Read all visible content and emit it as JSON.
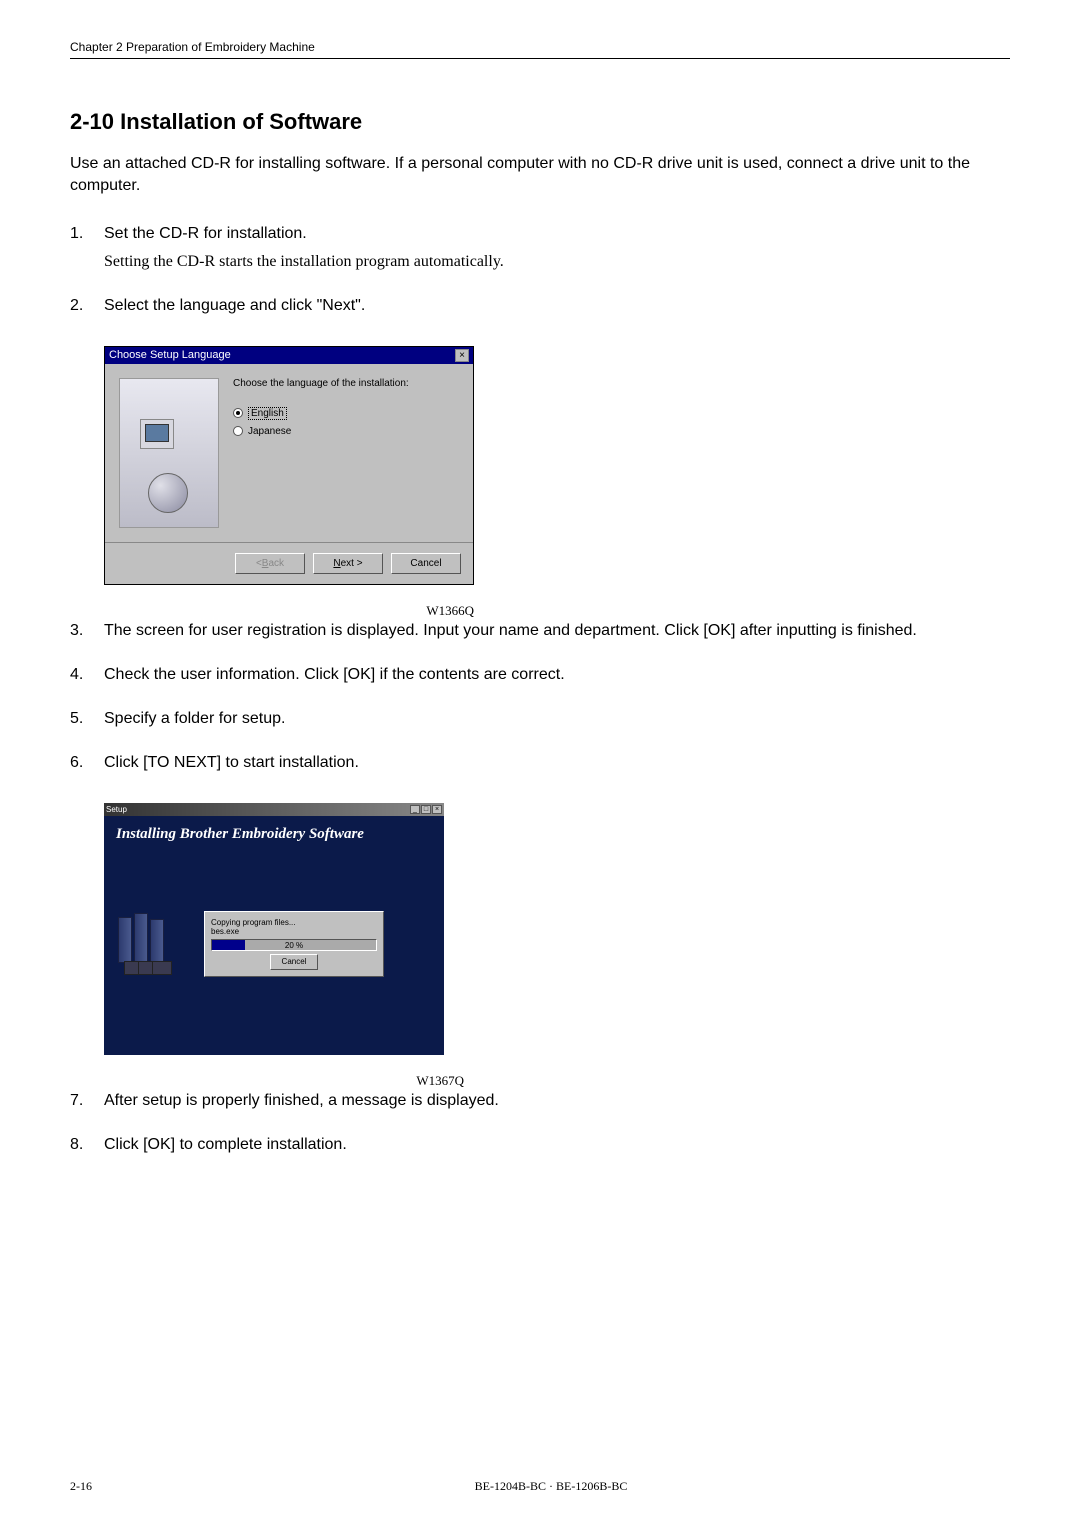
{
  "header": {
    "chapter": "Chapter 2 Preparation of Embroidery Machine"
  },
  "section": {
    "title": "2-10 Installation of Software",
    "intro": "Use an attached CD-R for installing software.    If a personal computer with no CD-R drive unit is used, connect a drive unit to the computer."
  },
  "steps": [
    {
      "num": "1.",
      "text": "Set the CD-R for installation.",
      "sub": "Setting the CD-R starts the installation program automatically."
    },
    {
      "num": "2.",
      "text": "Select the language and click \"Next\"."
    },
    {
      "num": "3.",
      "text": "The screen for user registration is displayed.    Input your name and department.    Click [OK] after inputting is finished."
    },
    {
      "num": "4.",
      "text": "Check the user information.    Click [OK] if the contents are correct."
    },
    {
      "num": "5.",
      "text": "Specify a folder for setup."
    },
    {
      "num": "6.",
      "text": "Click [TO NEXT] to start installation."
    },
    {
      "num": "7.",
      "text": "After setup is properly finished, a message is displayed."
    },
    {
      "num": "8.",
      "text": "Click [OK] to complete installation."
    }
  ],
  "dialog1": {
    "title": "Choose Setup Language",
    "instruction": "Choose the language of the installation:",
    "options": [
      "English",
      "Japanese"
    ],
    "buttons": {
      "back": "< Back",
      "next": "Next >",
      "cancel": "Cancel"
    }
  },
  "figure1": {
    "ref": "W1366Q"
  },
  "dialog2": {
    "windowTitle": "Setup",
    "heading": "Installing Brother Embroidery Software",
    "progress": {
      "line1": "Copying program files...",
      "line2": "bes.exe",
      "percent": "20 %",
      "cancel": "Cancel"
    }
  },
  "figure2": {
    "ref": "W1367Q"
  },
  "footer": {
    "page": "2-16",
    "model": "BE-1204B-BC · BE-1206B-BC"
  }
}
